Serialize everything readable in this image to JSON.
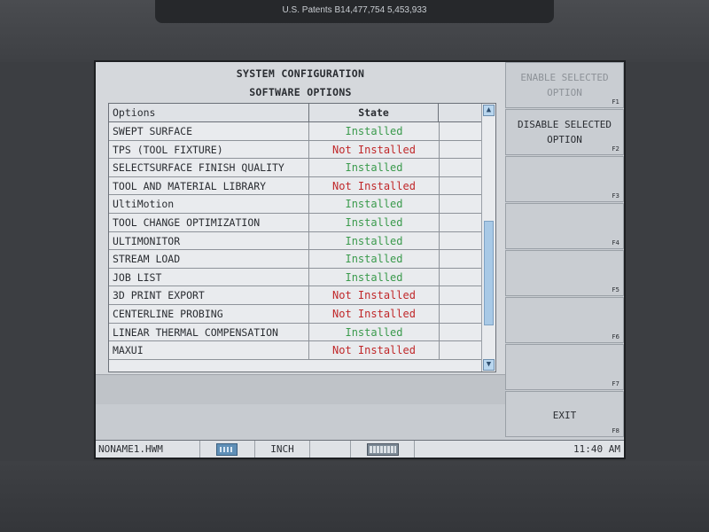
{
  "device": {
    "patent_text": "U.S. Patents B14,477,754 5,453,933"
  },
  "header": {
    "title_line1": "SYSTEM CONFIGURATION",
    "title_line2": "SOFTWARE OPTIONS"
  },
  "table": {
    "col_options": "Options",
    "col_state": "State",
    "rows": [
      {
        "option": "SWEPT SURFACE",
        "state": "Installed"
      },
      {
        "option": "TPS (TOOL FIXTURE)",
        "state": "Not Installed"
      },
      {
        "option": "SELECTSURFACE FINISH QUALITY",
        "state": "Installed"
      },
      {
        "option": "TOOL AND MATERIAL LIBRARY",
        "state": "Not Installed"
      },
      {
        "option": "UltiMotion",
        "state": "Installed"
      },
      {
        "option": "TOOL CHANGE OPTIMIZATION",
        "state": "Installed"
      },
      {
        "option": "ULTIMONITOR",
        "state": "Installed"
      },
      {
        "option": "STREAM LOAD",
        "state": "Installed"
      },
      {
        "option": "JOB LIST",
        "state": "Installed"
      },
      {
        "option": "3D PRINT EXPORT",
        "state": "Not Installed"
      },
      {
        "option": "CENTERLINE PROBING",
        "state": "Not Installed"
      },
      {
        "option": "LINEAR THERMAL COMPENSATION",
        "state": "Installed"
      },
      {
        "option": "MAXUI",
        "state": "Not Installed"
      }
    ],
    "colors": {
      "installed": "#3a9a4c",
      "not_installed": "#c0282a"
    }
  },
  "fkeys": [
    {
      "label_line1": "ENABLE SELECTED",
      "label_line2": "OPTION",
      "fnum": "F1",
      "enabled": false
    },
    {
      "label_line1": "DISABLE SELECTED",
      "label_line2": "OPTION",
      "fnum": "F2",
      "enabled": true
    },
    {
      "label_line1": "",
      "label_line2": "",
      "fnum": "F3",
      "enabled": true
    },
    {
      "label_line1": "",
      "label_line2": "",
      "fnum": "F4",
      "enabled": true
    },
    {
      "label_line1": "",
      "label_line2": "",
      "fnum": "F5",
      "enabled": true
    },
    {
      "label_line1": "",
      "label_line2": "",
      "fnum": "F6",
      "enabled": true
    },
    {
      "label_line1": "",
      "label_line2": "",
      "fnum": "F7",
      "enabled": true
    },
    {
      "label_line1": "EXIT",
      "label_line2": "",
      "fnum": "F8",
      "enabled": true
    }
  ],
  "statusbar": {
    "filename": "NONAME1.HWM",
    "calculator_icon": "calculator-icon",
    "units": "INCH",
    "keyboard_icon": "keyboard-icon",
    "time": "11:40 AM"
  }
}
